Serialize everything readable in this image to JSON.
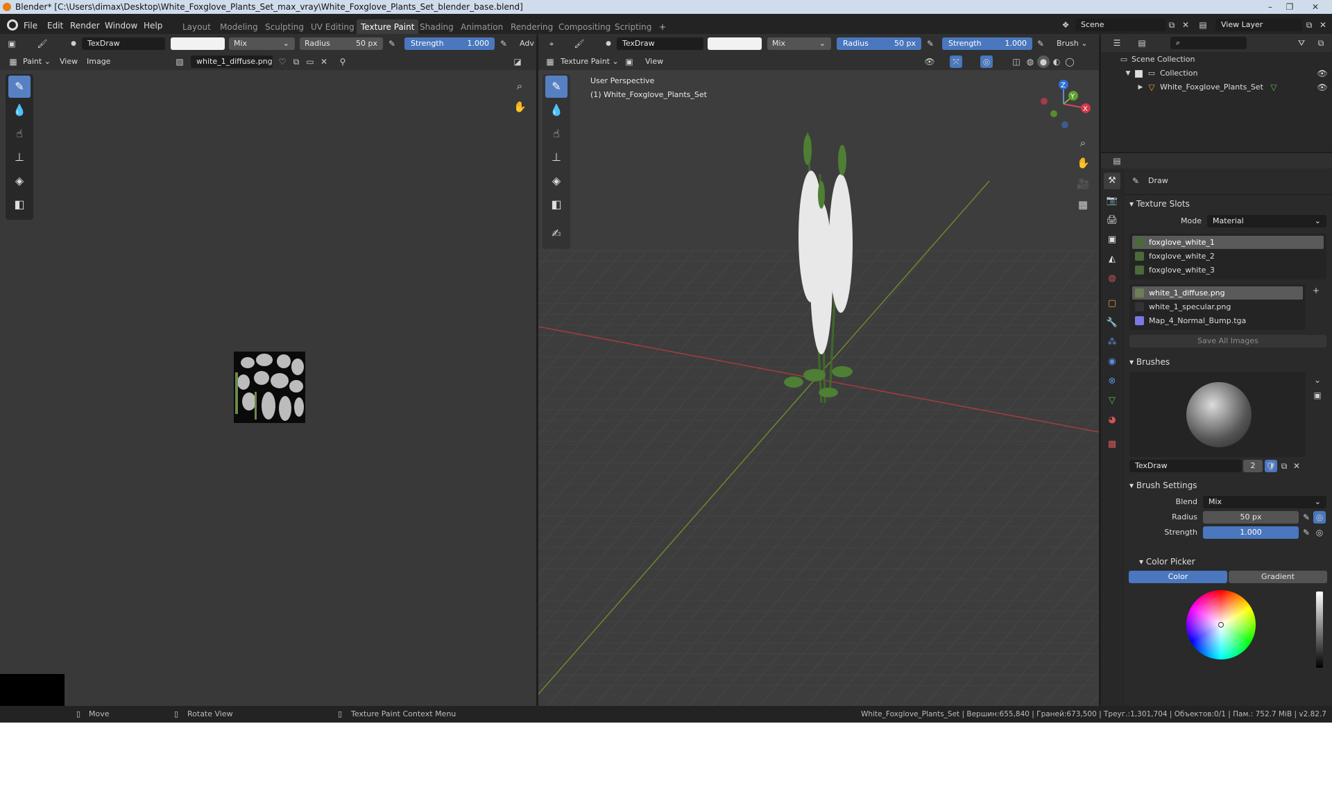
{
  "window": {
    "title": "Blender* [C:\\Users\\dimax\\Desktop\\White_Foxglove_Plants_Set_max_vray\\White_Foxglove_Plants_Set_blender_base.blend]",
    "controls": [
      "–",
      "❐",
      "✕"
    ]
  },
  "menu": [
    "File",
    "Edit",
    "Render",
    "Window",
    "Help"
  ],
  "workspaces": [
    "Layout",
    "Modeling",
    "Sculpting",
    "UV Editing",
    "Texture Paint",
    "Shading",
    "Animation",
    "Rendering",
    "Compositing",
    "Scripting"
  ],
  "workspace_add": "+",
  "scene": {
    "name": "Scene",
    "view_layer": "View Layer"
  },
  "left_editor": {
    "brush_name": "TexDraw",
    "blend": "Mix",
    "radius_label": "Radius",
    "radius_value": "50 px",
    "strength_label": "Strength",
    "strength_value": "1.000",
    "advanced": "Adv",
    "mode": "Paint",
    "menus": [
      "View",
      "Image"
    ],
    "image_name": "white_1_diffuse.png"
  },
  "viewport": {
    "brush_name": "TexDraw",
    "blend": "Mix",
    "radius_label": "Radius",
    "radius_value": "50 px",
    "strength_label": "Strength",
    "strength_value": "1.000",
    "brush_menu": "Brush",
    "mode": "Texture Paint",
    "view_menu": "View",
    "overlay_line1": "User Perspective",
    "overlay_line2": "(1) White_Foxglove_Plants_Set",
    "gizmo": {
      "z": "Z",
      "y": "Y",
      "x": "X"
    }
  },
  "outliner": {
    "root": "Scene Collection",
    "collection": "Collection",
    "object": "White_Foxglove_Plants_Set"
  },
  "properties": {
    "tool_name": "Draw",
    "texture_slots_header": "Texture Slots",
    "mode_label": "Mode",
    "mode_value": "Material",
    "materials": [
      "foxglove_white_1",
      "foxglove_white_2",
      "foxglove_white_3"
    ],
    "images": [
      "white_1_diffuse.png",
      "white_1_specular.png",
      "Map_4_Normal_Bump.tga"
    ],
    "save_all": "Save All Images",
    "brushes_header": "Brushes",
    "brush_name": "TexDraw",
    "brush_users": "2",
    "brush_settings_header": "Brush Settings",
    "blend_label": "Blend",
    "blend_value": "Mix",
    "radius_label": "Radius",
    "radius_value": "50 px",
    "strength_label": "Strength",
    "strength_value": "1.000",
    "color_picker_header": "Color Picker",
    "color_tab": "Color",
    "gradient_tab": "Gradient"
  },
  "status": {
    "move": "Move",
    "rotate": "Rotate View",
    "context": "Texture Paint Context Menu",
    "stats": "White_Foxglove_Plants_Set | Вершин:655,840 | Граней:673,500 | Треуг.:1,301,704 | Объектов:0/1 | Пам.: 752.7 MiB | v2.82.7"
  },
  "colors": {
    "accent": "#4a77bd",
    "active_tool": "#5680c2",
    "viewport_bg": "#3d3d3d"
  }
}
